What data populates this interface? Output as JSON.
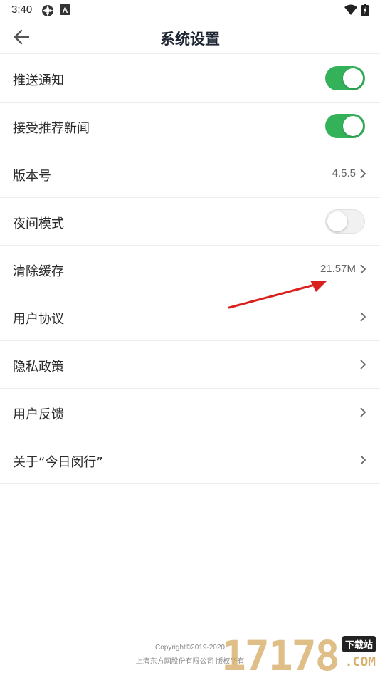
{
  "status_bar": {
    "time": "3:40",
    "icons": [
      "settings-app-icon",
      "a-notification-icon",
      "wifi-icon",
      "battery-icon"
    ]
  },
  "header": {
    "title": "系统设置",
    "back_icon": "back-arrow-icon"
  },
  "settings": [
    {
      "label": "推送通知",
      "type": "toggle",
      "enabled": true
    },
    {
      "label": "接受推荐新闻",
      "type": "toggle",
      "enabled": true
    },
    {
      "label": "版本号",
      "type": "value",
      "value": "4.5.5"
    },
    {
      "label": "夜间模式",
      "type": "toggle",
      "enabled": false
    },
    {
      "label": "清除缓存",
      "type": "value",
      "value": "21.57M"
    },
    {
      "label": "用户协议",
      "type": "link"
    },
    {
      "label": "隐私政策",
      "type": "link"
    },
    {
      "label": "用户反馈",
      "type": "link"
    },
    {
      "label": "关于“今日闵行”",
      "type": "link"
    }
  ],
  "footer": {
    "copyright": "Copyright©2019-2020",
    "company": "上海东方网股份有限公司 版权所有"
  },
  "watermark": {
    "number": "17178",
    "tag": "下载站",
    "suffix": ".COM"
  },
  "colors": {
    "toggle_on": "#34b25a",
    "toggle_off": "#f1f1f1",
    "title": "#1f2633",
    "annotation_arrow": "#d9201c",
    "watermark": "#d8b06a"
  }
}
